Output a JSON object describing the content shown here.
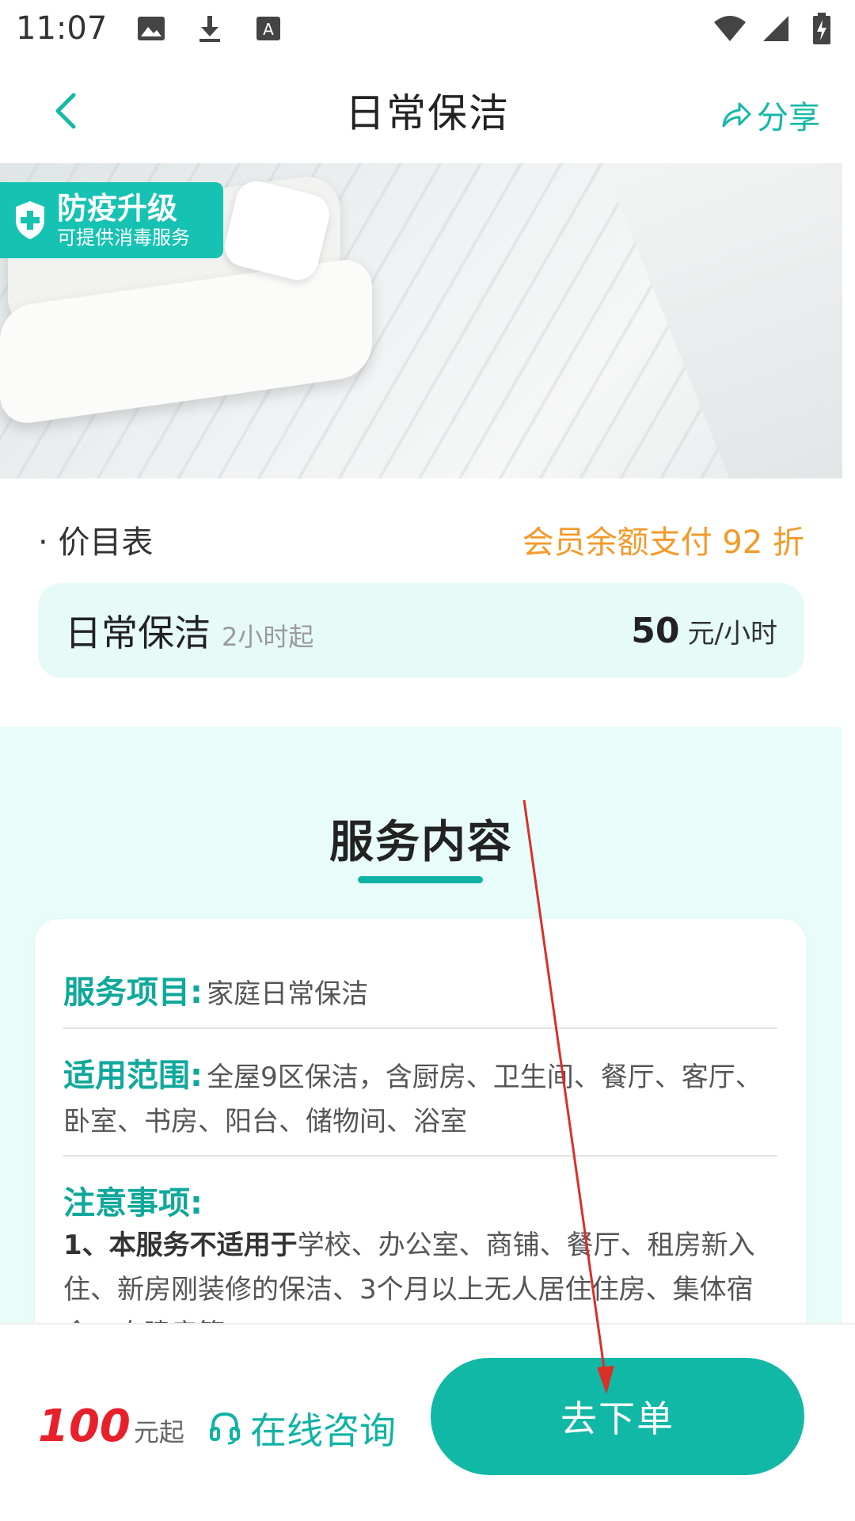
{
  "status_bar": {
    "time": "11:07",
    "left_icons": [
      "image-icon",
      "download-icon",
      "text-icon"
    ],
    "right_icons": [
      "wifi-icon",
      "signal-icon",
      "battery-icon"
    ]
  },
  "header": {
    "title": "日常保洁",
    "share_label": "分享"
  },
  "hero": {
    "badge_title": "防疫升级",
    "badge_subtitle": "可提供消毒服务"
  },
  "price_section": {
    "label": "· 价目表",
    "member_discount": "会员余额支付 92 折",
    "item_name": "日常保洁",
    "item_min": "2小时起",
    "item_price": "50",
    "item_unit": "元/小时"
  },
  "service": {
    "title": "服务内容",
    "rows": [
      {
        "label": "服务项目:",
        "value": "家庭日常保洁"
      },
      {
        "label": "适用范围:",
        "value": "全屋9区保洁，含厨房、卫生间、餐厅、客厅、卧室、书房、阳台、储物间、浴室"
      }
    ],
    "notes_label": "注意事项:",
    "note_strong": "1、本服务不适用于",
    "note_rest": "学校、办公室、商铺、餐厅、租房新入住、新房刚装修的保洁、3个月以上无人居住住房、集体宿舍、自建房等;"
  },
  "bottom": {
    "price_value": "100",
    "price_unit": "元起",
    "consult_label": "在线咨询",
    "order_label": "去下单"
  },
  "colors": {
    "accent": "#12b8a6",
    "discount": "#f39a2b",
    "price_red": "#e8202a",
    "section_bg": "#e8fdfa"
  }
}
